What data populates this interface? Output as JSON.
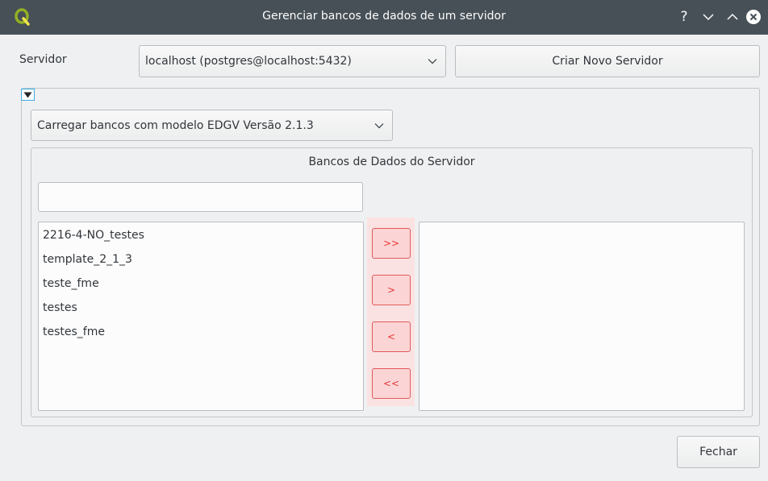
{
  "window": {
    "title": "Gerenciar bancos de dados de um servidor",
    "help_glyph": "?"
  },
  "server_row": {
    "label": "Servidor",
    "selected_server": "localhost (postgres@localhost:5432)",
    "create_button_label": "Criar Novo Servidor"
  },
  "template_combo": {
    "selected": "Carregar bancos com modelo EDGV Versão 2.1.3"
  },
  "databases_group": {
    "title": "Bancos de Dados do Servidor",
    "filter_value": "",
    "available": [
      "2216-4-NO_testes",
      "template_2_1_3",
      "teste_fme",
      "testes",
      "testes_fme"
    ],
    "selected": [],
    "transfer_buttons": {
      "add_all": ">>",
      "add": ">",
      "remove": "<",
      "remove_all": "<<"
    }
  },
  "footer": {
    "close_label": "Fechar"
  },
  "colors": {
    "titlebar": "#475057",
    "window_bg": "#eff0f1",
    "transfer_accent": "#e8373b",
    "focus_accent": "#3daee9"
  },
  "icons": {
    "app": "qgis-logo-icon",
    "help": "help-icon",
    "minimize": "chevron-down-icon",
    "maximize": "chevron-up-icon",
    "close": "close-circle-icon",
    "collapse": "triangle-down-icon",
    "combo_arrow": "chevron-down-icon"
  }
}
